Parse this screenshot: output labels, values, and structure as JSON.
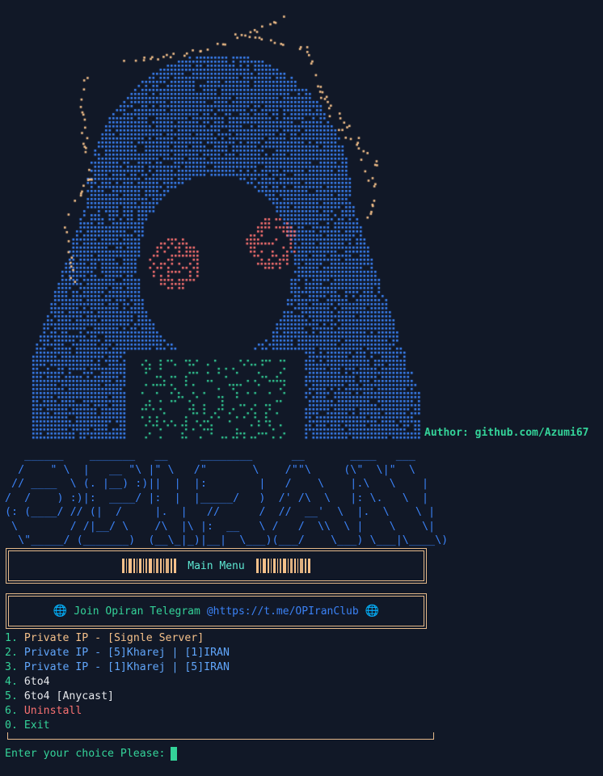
{
  "author": "Author: github.com/Azumi67",
  "ascii_art": {
    "description_icon": "anime-girl-ascii-art",
    "colors": {
      "hair": "#3b82f6",
      "strands": "#f4c08a",
      "eyes": "#f87171",
      "collar": "#34d399"
    }
  },
  "logo_lines": [
    "   ______    _______   __     ________      __       ____   ___",
    "  /    \" \\  |   __ \"\\ |\" \\   /\"       \\    /\"\"\\     (\\\"  \\|\"  \\",
    " // ____  \\ (. |__) :)||  |  |:        |   /    \\    |.\\   \\    |",
    "/  /    ) :)|:  ____/ |:  |  |_____/   )  /' /\\  \\   |: \\.   \\  |",
    "(: (____/ // (|  /     |.  |   //      /  //  __'  \\  |.  \\    \\ |",
    " \\        / /|__/ \\    /\\  |\\ |:  __   \\ /   /  \\\\  \\ |    \\    \\|",
    "  \\\"_____/ (_______)  (__\\_|_)|__|  \\___)(___/    \\___) \\___|\\____\\)"
  ],
  "menu": {
    "title": "Main Menu",
    "telegram_label": "Join Opiran Telegram",
    "telegram_link": "@https://t.me/OPIranClub",
    "globe_icon": "🌐"
  },
  "options": [
    {
      "num": "1.",
      "label": "Private IP - [Signle Server]",
      "color": "orange"
    },
    {
      "num": "2.",
      "label": "Private IP - [5]Kharej | [1]IRAN",
      "color": "blue"
    },
    {
      "num": "3.",
      "label": "Private IP - [1]Kharej | [5]IRAN",
      "color": "blue"
    },
    {
      "num": "4.",
      "label": "6to4",
      "color": "white"
    },
    {
      "num": "5.",
      "label": "6to4 [Anycast]",
      "color": "white"
    },
    {
      "num": "6.",
      "label": "Uninstall",
      "color": "red"
    },
    {
      "num": "0.",
      "label": "Exit",
      "color": "green"
    }
  ],
  "prompt": "Enter your choice Please:"
}
